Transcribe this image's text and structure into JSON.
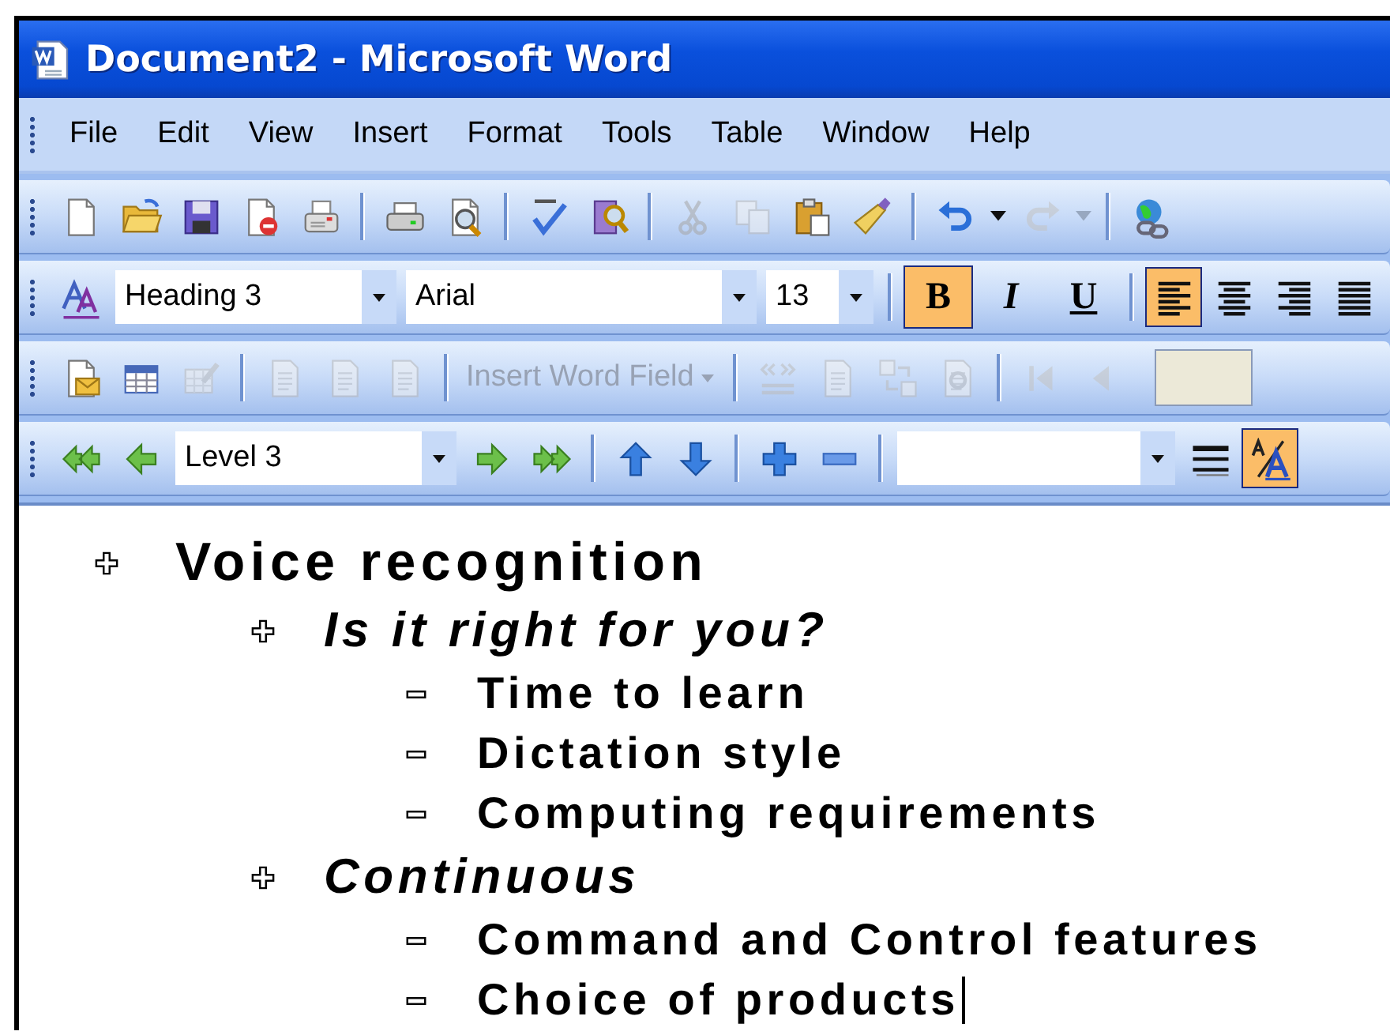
{
  "window": {
    "title": "Document2 - Microsoft Word"
  },
  "menu": [
    {
      "label": "File"
    },
    {
      "label": "Edit"
    },
    {
      "label": "View"
    },
    {
      "label": "Insert"
    },
    {
      "label": "Format"
    },
    {
      "label": "Tools"
    },
    {
      "label": "Table"
    },
    {
      "label": "Window"
    },
    {
      "label": "Help"
    }
  ],
  "toolbars": [
    {
      "items": [
        {
          "kind": "icon",
          "disabled": false
        },
        {
          "kind": "icon",
          "disabled": false
        },
        {
          "kind": "icon",
          "disabled": false
        },
        {
          "kind": "icon",
          "disabled": false
        },
        {
          "kind": "icon",
          "disabled": false
        },
        {
          "kind": "separator"
        },
        {
          "kind": "icon",
          "disabled": false
        },
        {
          "kind": "icon",
          "disabled": false
        },
        {
          "kind": "separator"
        },
        {
          "kind": "icon",
          "disabled": false
        },
        {
          "kind": "icon",
          "disabled": false
        },
        {
          "kind": "separator"
        },
        {
          "kind": "icon",
          "disabled": true
        },
        {
          "kind": "icon",
          "disabled": true
        },
        {
          "kind": "icon",
          "disabled": false
        },
        {
          "kind": "icon",
          "disabled": false
        },
        {
          "kind": "separator"
        },
        {
          "kind": "icon",
          "disabled": false
        },
        {
          "kind": "dropdown",
          "disabled": false
        },
        {
          "kind": "icon",
          "disabled": true
        },
        {
          "kind": "dropdown",
          "disabled": true
        },
        {
          "kind": "separator"
        },
        {
          "kind": "icon",
          "disabled": false
        }
      ]
    },
    {
      "items": [
        {
          "kind": "icon",
          "disabled": false
        },
        {
          "kind": "combo",
          "value": "Heading 3"
        },
        {
          "kind": "combo",
          "value": "Arial"
        },
        {
          "kind": "combo",
          "value": "13"
        },
        {
          "kind": "separator"
        },
        {
          "kind": "toggle",
          "label": "B",
          "selected": true
        },
        {
          "kind": "toggle",
          "label": "I",
          "selected": false
        },
        {
          "kind": "toggle",
          "label": "U",
          "selected": false
        },
        {
          "kind": "separator"
        },
        {
          "kind": "icon-toggle",
          "selected": true
        },
        {
          "kind": "icon-toggle",
          "selected": false
        },
        {
          "kind": "icon-toggle",
          "selected": false
        },
        {
          "kind": "icon-toggle",
          "selected": false
        }
      ]
    },
    {
      "items": [
        {
          "kind": "icon",
          "disabled": false
        },
        {
          "kind": "icon",
          "disabled": false
        },
        {
          "kind": "icon",
          "disabled": true
        },
        {
          "kind": "separator"
        },
        {
          "kind": "icon",
          "disabled": true
        },
        {
          "kind": "icon",
          "disabled": true
        },
        {
          "kind": "icon",
          "disabled": true
        },
        {
          "kind": "separator"
        },
        {
          "kind": "text-button",
          "label": "Insert Word Field",
          "disabled": true
        },
        {
          "kind": "separator"
        },
        {
          "kind": "icon",
          "disabled": true
        },
        {
          "kind": "icon",
          "disabled": true
        },
        {
          "kind": "icon",
          "disabled": true
        },
        {
          "kind": "icon",
          "disabled": true
        },
        {
          "kind": "separator"
        },
        {
          "kind": "icon",
          "disabled": true
        },
        {
          "kind": "icon",
          "disabled": true
        },
        {
          "kind": "field",
          "disabled": true
        }
      ]
    },
    {
      "items": [
        {
          "kind": "icon",
          "disabled": false
        },
        {
          "kind": "icon",
          "disabled": false
        },
        {
          "kind": "combo",
          "value": "Level 3"
        },
        {
          "kind": "icon",
          "disabled": false
        },
        {
          "kind": "icon",
          "disabled": false
        },
        {
          "kind": "separator"
        },
        {
          "kind": "icon",
          "disabled": false
        },
        {
          "kind": "icon",
          "disabled": false
        },
        {
          "kind": "separator"
        },
        {
          "kind": "icon",
          "disabled": false
        },
        {
          "kind": "icon",
          "disabled": false
        },
        {
          "kind": "separator"
        },
        {
          "kind": "combo"
        },
        {
          "kind": "icon",
          "disabled": false
        },
        {
          "kind": "icon-toggle",
          "selected": true
        }
      ]
    }
  ],
  "outline": [
    {
      "text": "Voice recognition",
      "children": [
        {
          "text": "Is it right for you?",
          "children": [
            {
              "text": "Time to learn"
            },
            {
              "text": "Dictation style"
            },
            {
              "text": "Computing requirements"
            }
          ]
        },
        {
          "text": "Continuous",
          "children": [
            {
              "text": "Command and Control features"
            },
            {
              "text": "Choice of products",
              "cursor": true
            }
          ]
        }
      ]
    }
  ]
}
